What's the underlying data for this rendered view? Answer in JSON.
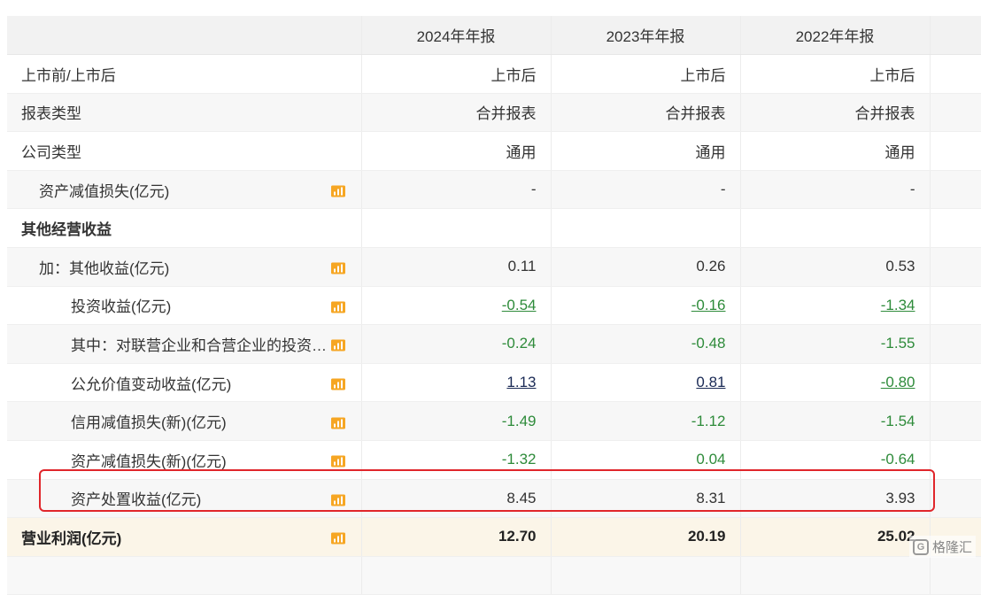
{
  "table": {
    "headers": [
      "",
      "2024年年报",
      "2023年年报",
      "2022年年报"
    ],
    "rows": [
      {
        "label": "上市前/上市后",
        "level": 0,
        "bold": false,
        "icon": false,
        "style": "normal",
        "values": [
          "上市后",
          "上市后",
          "上市后"
        ],
        "value_style": "plain"
      },
      {
        "label": "报表类型",
        "level": 0,
        "bold": false,
        "icon": false,
        "style": "alt",
        "values": [
          "合并报表",
          "合并报表",
          "合并报表"
        ],
        "value_style": "plain"
      },
      {
        "label": "公司类型",
        "level": 0,
        "bold": false,
        "icon": false,
        "style": "normal",
        "values": [
          "通用",
          "通用",
          "通用"
        ],
        "value_style": "plain"
      },
      {
        "label": "资产减值损失(亿元)",
        "level": 1,
        "bold": false,
        "icon": true,
        "style": "alt",
        "values": [
          "-",
          "-",
          "-"
        ],
        "value_style": "plain"
      },
      {
        "label": "其他经营收益",
        "level": 0,
        "bold": true,
        "icon": false,
        "style": "normal",
        "values": [
          "",
          "",
          ""
        ],
        "value_style": "plain"
      },
      {
        "label": "加：其他收益(亿元)",
        "level": 1,
        "bold": false,
        "icon": true,
        "style": "alt",
        "values": [
          "0.11",
          "0.26",
          "0.53"
        ],
        "value_style": "plain"
      },
      {
        "label": "投资收益(亿元)",
        "level": 2,
        "bold": false,
        "icon": true,
        "style": "normal",
        "values": [
          "-0.54",
          "-0.16",
          "-1.34"
        ],
        "value_style": "green-ul"
      },
      {
        "label": "其中：对联营企业和合营企业的投资收益(亿元)",
        "level": 2,
        "bold": false,
        "icon": true,
        "style": "alt",
        "values": [
          "-0.24",
          "-0.48",
          "-1.55"
        ],
        "value_style": "green"
      },
      {
        "label": "公允价值变动收益(亿元)",
        "level": 2,
        "bold": false,
        "icon": true,
        "style": "normal",
        "values": [
          "1.13",
          "0.81",
          "-0.80"
        ],
        "value_style": "mixed-ul"
      },
      {
        "label": "信用减值损失(新)(亿元)",
        "level": 2,
        "bold": false,
        "icon": true,
        "style": "alt",
        "values": [
          "-1.49",
          "-1.12",
          "-1.54"
        ],
        "value_style": "green"
      },
      {
        "label": "资产减值损失(新)(亿元)",
        "level": 2,
        "bold": false,
        "icon": true,
        "style": "normal",
        "values": [
          "-1.32",
          "0.04",
          "-0.64"
        ],
        "value_style": "green"
      },
      {
        "label": "资产处置收益(亿元)",
        "level": 2,
        "bold": false,
        "icon": true,
        "style": "alt",
        "values": [
          "8.45",
          "8.31",
          "3.93"
        ],
        "value_style": "plain"
      },
      {
        "label": "营业利润(亿元)",
        "level": 0,
        "bold": true,
        "icon": true,
        "style": "profit",
        "values": [
          "12.70",
          "20.19",
          "25.02"
        ],
        "value_style": "plain"
      }
    ]
  },
  "watermark": {
    "mark": "G",
    "text": "格隆汇"
  },
  "colors": {
    "negative": "#2e8b3a",
    "positive_link": "#1a2a55",
    "highlight": "#e0262b",
    "header_bg": "#f2f2f2",
    "profit_bg": "#fbf5e8"
  },
  "icons": {
    "row_chart": "bar-chart-icon"
  }
}
